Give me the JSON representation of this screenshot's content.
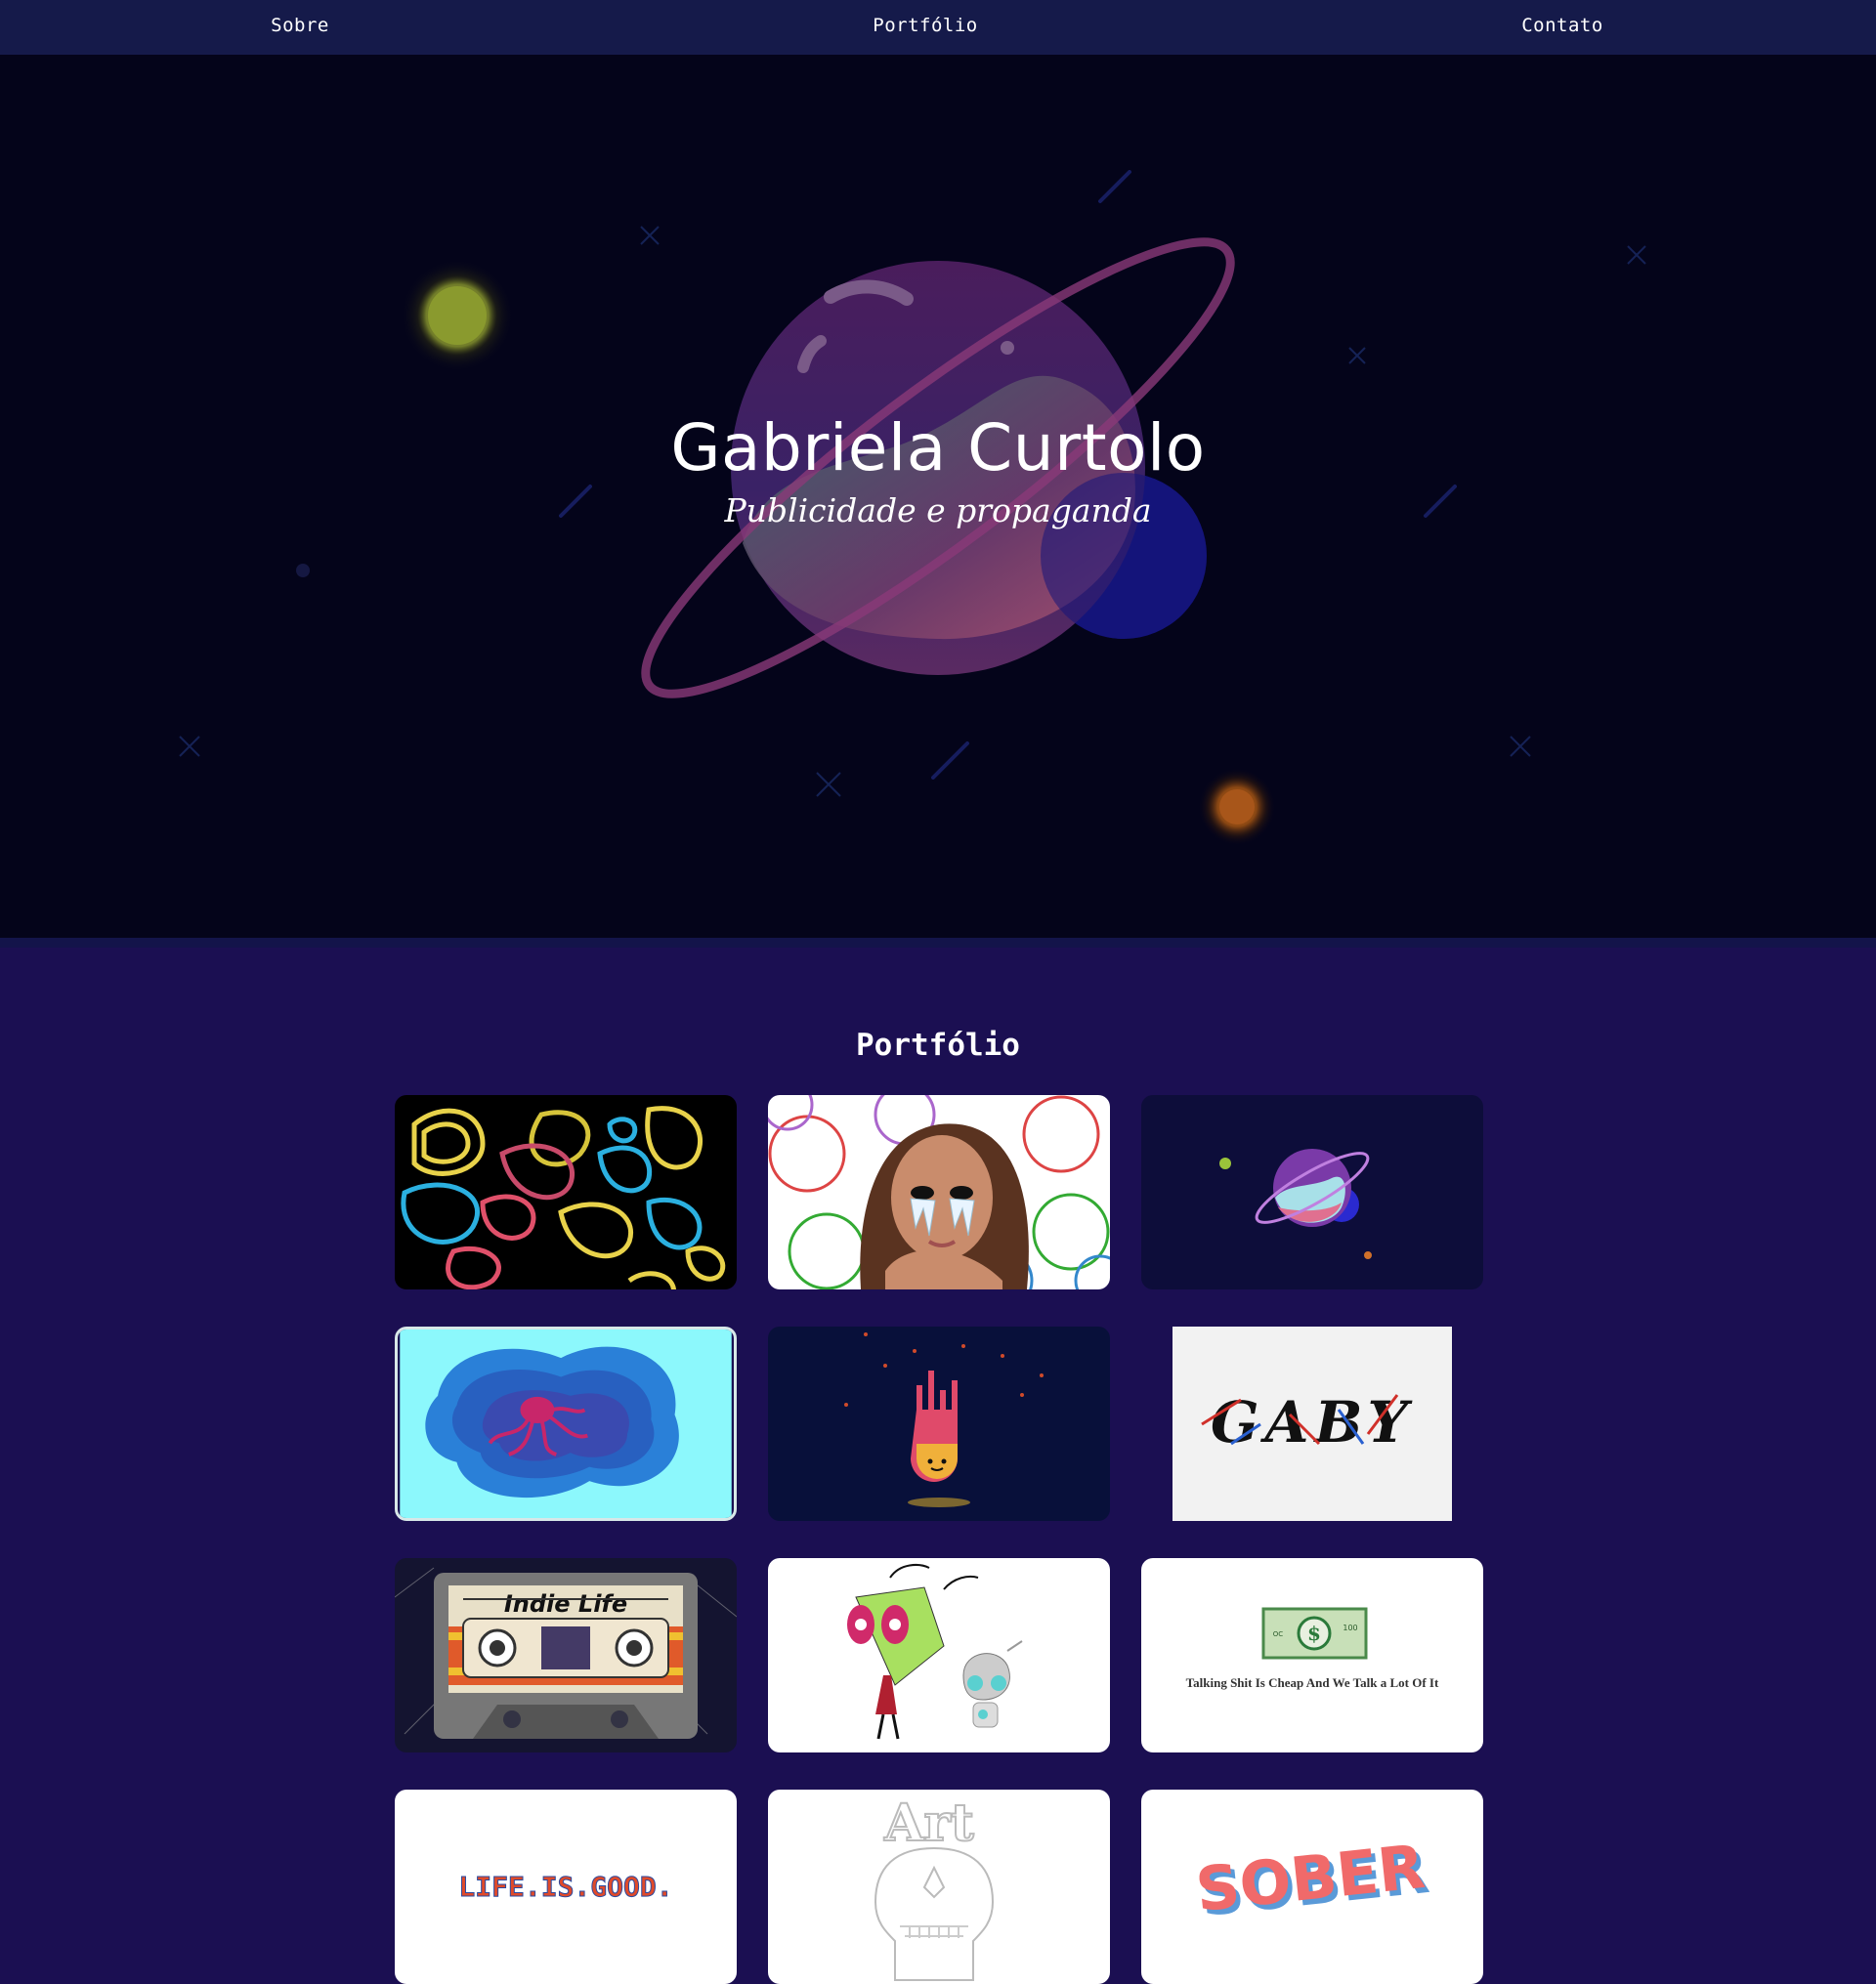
{
  "nav": {
    "items": [
      "Sobre",
      "Portfólio",
      "Contato"
    ]
  },
  "hero": {
    "title": "Gabriela Curtolo",
    "subtitle": "Publicidade e propaganda"
  },
  "portfolio": {
    "title": "Portfólio",
    "cards": [
      {
        "name": "topographic-art"
      },
      {
        "name": "crying-portrait"
      },
      {
        "name": "planet-illustration"
      },
      {
        "name": "octopus-papercut"
      },
      {
        "name": "candle-drip"
      },
      {
        "name": "gaby-lettering",
        "text": "GABY"
      },
      {
        "name": "indie-life-cassette",
        "text": "Indie Life"
      },
      {
        "name": "invader-zim"
      },
      {
        "name": "money-quote",
        "text": "Talking Shit Is Cheap And We Talk a Lot Of It"
      },
      {
        "name": "life-is-good",
        "text": "LIFE.IS.GOOD."
      },
      {
        "name": "skull-art",
        "text": "Art"
      },
      {
        "name": "sober-lettering",
        "text": "SOBER"
      }
    ]
  },
  "colors": {
    "page_bg": "#1b0f52",
    "nav_bg": "#151a4a",
    "hero_bg": "#04041a"
  }
}
